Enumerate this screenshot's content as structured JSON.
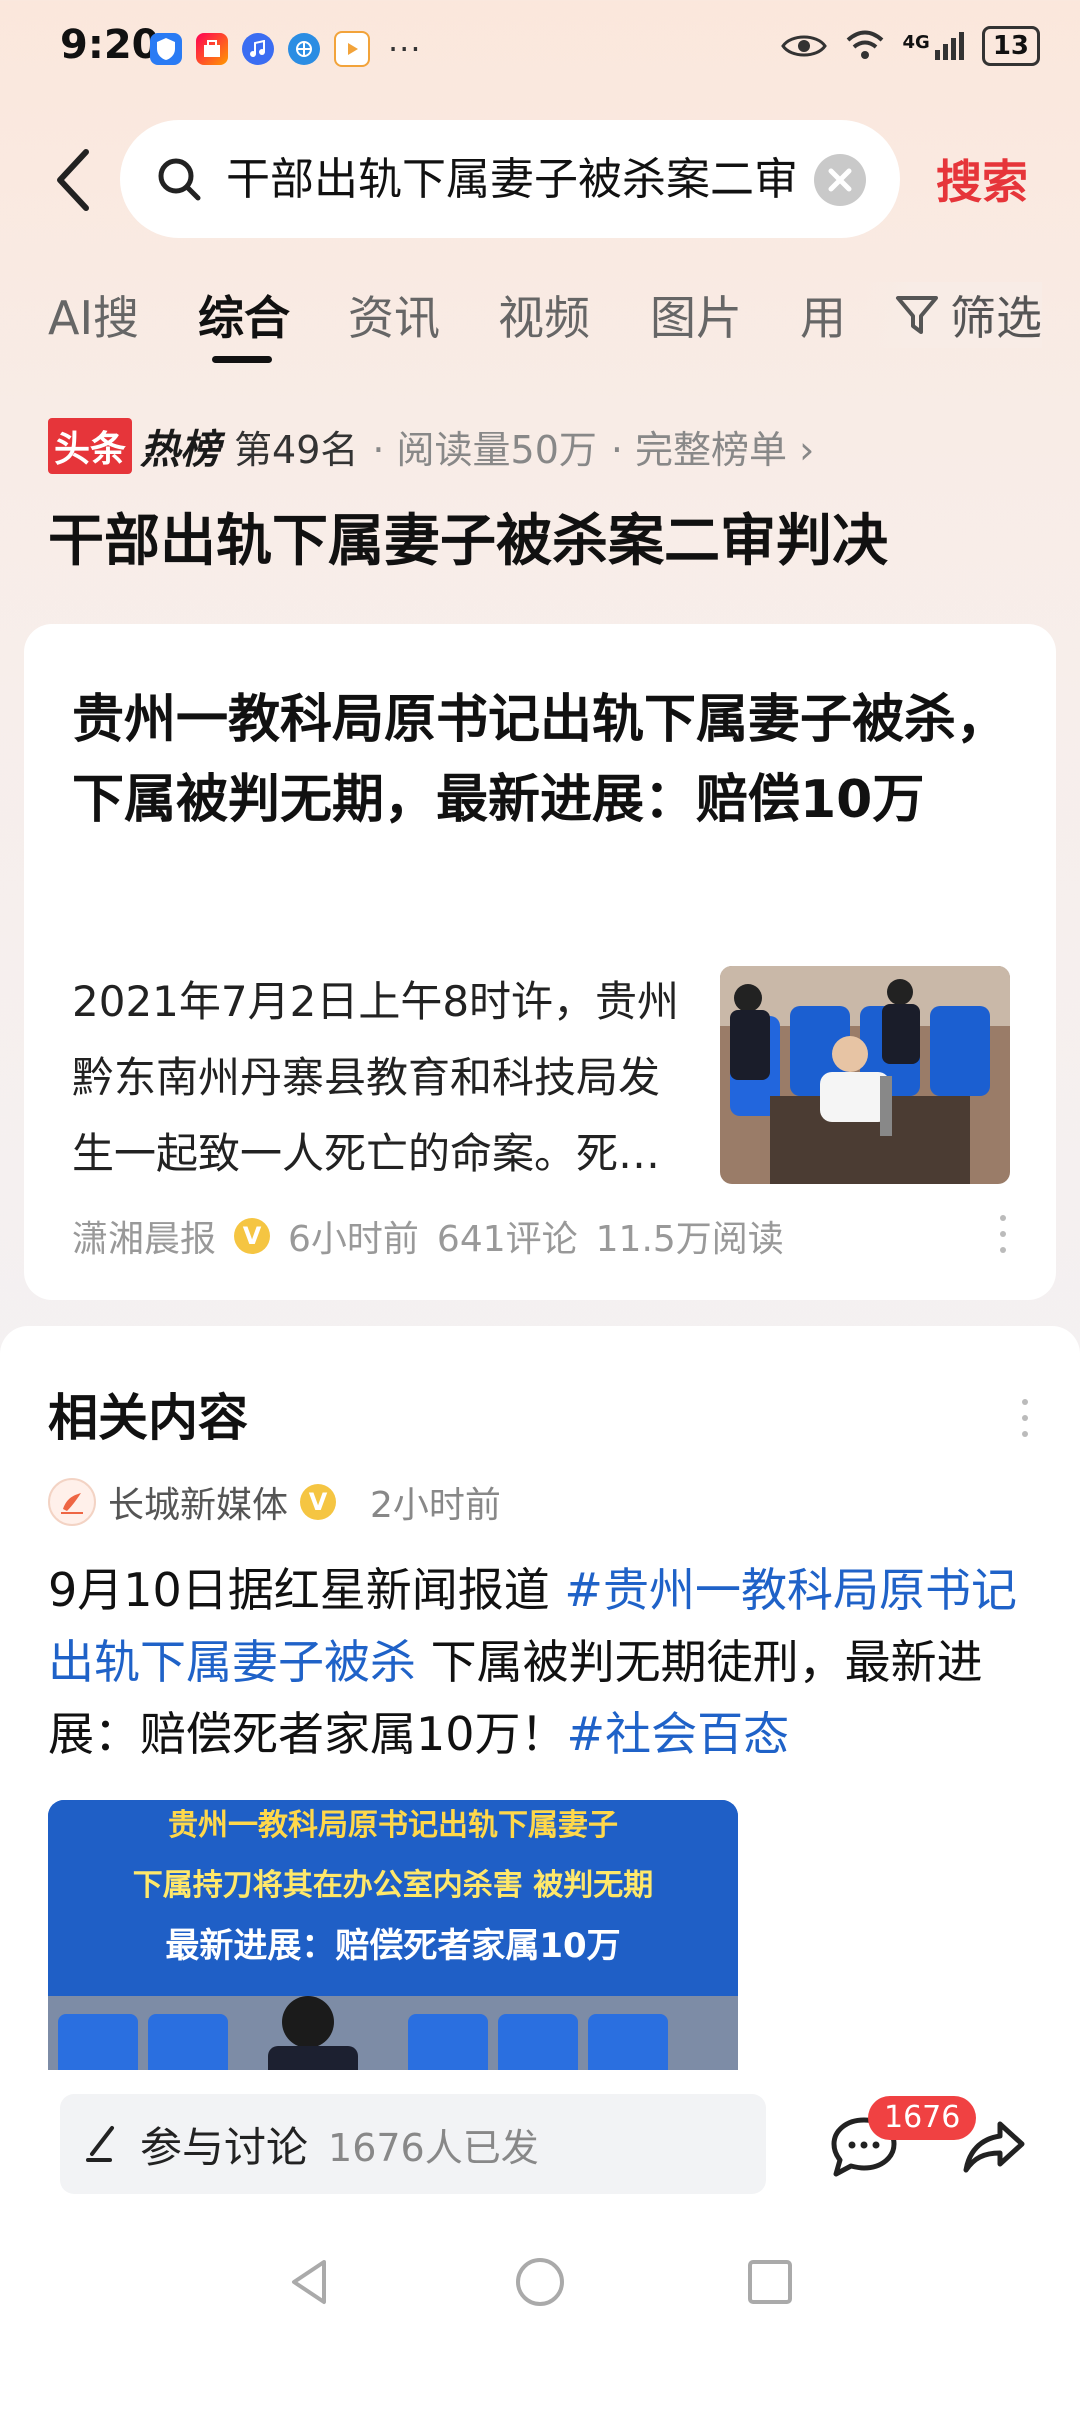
{
  "status_bar": {
    "time": "9:20",
    "network": "4G",
    "battery": "13",
    "more": "···"
  },
  "search": {
    "query": "干部出轨下属妻子被杀案二审",
    "submit_label": "搜索"
  },
  "tabs": [
    {
      "label": "AI搜"
    },
    {
      "label": "综合"
    },
    {
      "label": "资讯"
    },
    {
      "label": "视频"
    },
    {
      "label": "图片"
    },
    {
      "label": "用"
    }
  ],
  "filter_label": "筛选",
  "hot_list": {
    "badge_a": "头条",
    "badge_b": "热榜",
    "rank": "第49名",
    "reads": "· 阅读量50万",
    "full_list": "· 完整榜单 ›",
    "title": "干部出轨下属妻子被杀案二审判决"
  },
  "card1": {
    "title": "贵州一教科局原书记出轨下属妻子被杀，下属被判无期，最新进展：赔偿10万",
    "summary": "2021年7月2日上午8时许，贵州黔东南州丹寨县教育和科技局发生一起致一人死亡的命案。死…",
    "source": "潇湘晨报",
    "time": "6小时前",
    "comments": "641评论",
    "reads": "11.5万阅读"
  },
  "card2": {
    "heading": "相关内容",
    "source": "长城新媒体",
    "time": "2小时前",
    "body_prefix": "9月10日据红星新闻报道 ",
    "hashtag1": "#贵州一教科局原书记出轨下属妻子被杀",
    "body_middle": " 下属被判无期徒刑，最新进展：赔偿死者家属10万！",
    "hashtag2": "#社会百态",
    "image_captions": [
      "贵州一教科局原书记出轨下属妻子",
      "下属持刀将其在办公室内杀害 被判无期",
      "最新进展：赔偿死者家属10万"
    ]
  },
  "bottom_bar": {
    "discuss_label": "参与讨论",
    "discuss_count": "1676人已发",
    "comment_badge": "1676"
  },
  "colors": {
    "accent_red": "#e6353a",
    "hashtag_blue": "#1f62c8",
    "verified_gold": "#f5c542"
  }
}
